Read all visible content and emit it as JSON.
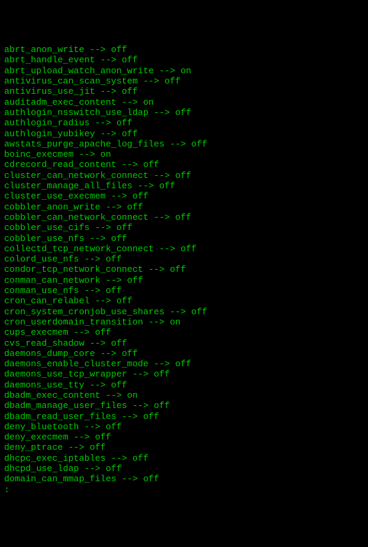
{
  "booleans": [
    {
      "name": "abrt_anon_write",
      "value": "off"
    },
    {
      "name": "abrt_handle_event",
      "value": "off"
    },
    {
      "name": "abrt_upload_watch_anon_write",
      "value": "on"
    },
    {
      "name": "antivirus_can_scan_system",
      "value": "off"
    },
    {
      "name": "antivirus_use_jit",
      "value": "off"
    },
    {
      "name": "auditadm_exec_content",
      "value": "on"
    },
    {
      "name": "authlogin_nsswitch_use_ldap",
      "value": "off"
    },
    {
      "name": "authlogin_radius",
      "value": "off"
    },
    {
      "name": "authlogin_yubikey",
      "value": "off"
    },
    {
      "name": "awstats_purge_apache_log_files",
      "value": "off"
    },
    {
      "name": "boinc_execmem",
      "value": "on"
    },
    {
      "name": "cdrecord_read_content",
      "value": "off"
    },
    {
      "name": "cluster_can_network_connect",
      "value": "off"
    },
    {
      "name": "cluster_manage_all_files",
      "value": "off"
    },
    {
      "name": "cluster_use_execmem",
      "value": "off"
    },
    {
      "name": "cobbler_anon_write",
      "value": "off"
    },
    {
      "name": "cobbler_can_network_connect",
      "value": "off"
    },
    {
      "name": "cobbler_use_cifs",
      "value": "off"
    },
    {
      "name": "cobbler_use_nfs",
      "value": "off"
    },
    {
      "name": "collectd_tcp_network_connect",
      "value": "off"
    },
    {
      "name": "colord_use_nfs",
      "value": "off"
    },
    {
      "name": "condor_tcp_network_connect",
      "value": "off"
    },
    {
      "name": "conman_can_network",
      "value": "off"
    },
    {
      "name": "conman_use_nfs",
      "value": "off"
    },
    {
      "name": "cron_can_relabel",
      "value": "off"
    },
    {
      "name": "cron_system_cronjob_use_shares",
      "value": "off"
    },
    {
      "name": "cron_userdomain_transition",
      "value": "on"
    },
    {
      "name": "cups_execmem",
      "value": "off"
    },
    {
      "name": "cvs_read_shadow",
      "value": "off"
    },
    {
      "name": "daemons_dump_core",
      "value": "off"
    },
    {
      "name": "daemons_enable_cluster_mode",
      "value": "off"
    },
    {
      "name": "daemons_use_tcp_wrapper",
      "value": "off"
    },
    {
      "name": "daemons_use_tty",
      "value": "off"
    },
    {
      "name": "dbadm_exec_content",
      "value": "on"
    },
    {
      "name": "dbadm_manage_user_files",
      "value": "off"
    },
    {
      "name": "dbadm_read_user_files",
      "value": "off"
    },
    {
      "name": "deny_bluetooth",
      "value": "off"
    },
    {
      "name": "deny_execmem",
      "value": "off"
    },
    {
      "name": "deny_ptrace",
      "value": "off"
    },
    {
      "name": "dhcpc_exec_iptables",
      "value": "off"
    },
    {
      "name": "dhcpd_use_ldap",
      "value": "off"
    },
    {
      "name": "domain_can_mmap_files",
      "value": "off"
    }
  ],
  "prompt": ":"
}
